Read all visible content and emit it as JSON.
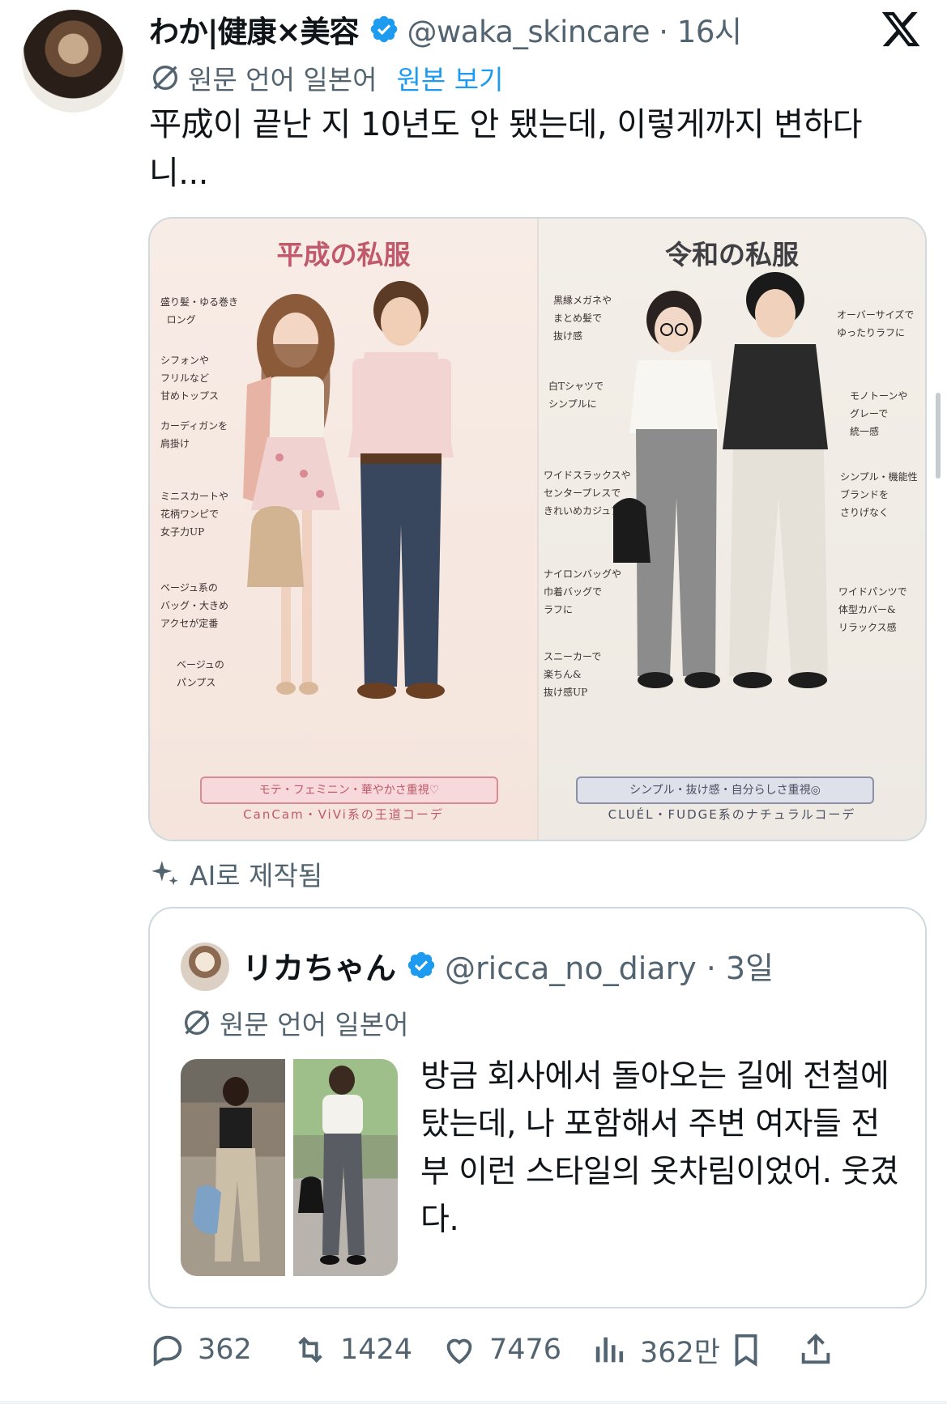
{
  "tweet": {
    "author_name": "わか|健康×美容",
    "handle_time": "@waka_skincare · 16시",
    "translation_note": "원문 언어 일본어",
    "show_original": "원본 보기",
    "text": "平成이 끝난 지 10년도 안 됐는데, 이렇게까지 변하다니...",
    "ai_label": "AI로 제작됨"
  },
  "image": {
    "left_panel": {
      "title": "平成の私服",
      "notes": [
        "盛り髪・ゆる巻き\n  ロング",
        "シフォンや\nフリルなど\n甘めトップス",
        "カーディガンを\n肩掛け",
        "ミニスカートや\n花柄ワンピで\n女子力UP",
        "ベージュ系の\nバッグ・大きめ\nアクセが定番",
        "ベージュの\nパンプス"
      ],
      "tagline": "モテ・フェミニン・華やかさ重視♡",
      "caption": "CanCam・ViVi系の王道コーデ"
    },
    "right_panel": {
      "title": "令和の私服",
      "notes_left": [
        "黒縁メガネや\nまとめ髪で\n抜け感",
        "白Tシャツで\nシンプルに",
        "ワイドスラックスや\nセンタープレスで\nきれいめカジュアル",
        "ナイロンバッグや\n巾着バッグで\nラフに",
        "スニーカーで\n楽ちん&\n抜け感UP"
      ],
      "notes_right": [
        "オーバーサイズで\nゆったりラフに",
        "モノトーンや\nグレーで\n統一感",
        "シンプル・機能性\nブランドを\nさりげなく",
        "ワイドパンツで\n体型カバー&\nリラックス感"
      ],
      "tagline": "シンプル・抜け感・自分らしさ重視◎",
      "caption": "CLUÉL・FUDGE系のナチュラルコーデ"
    }
  },
  "quote": {
    "author_name": "リカちゃん",
    "handle_time": "@ricca_no_diary · 3일",
    "translation_note": "원문 언어 일본어",
    "text": "방금 회사에서 돌아오는 길에 전철에 탔는데, 나 포함해서 주변 여자들 전부 이런 스타일의 옷차림이었어. 웃겼다."
  },
  "actions": {
    "replies": "362",
    "retweets": "1424",
    "likes": "7476",
    "views": "362만"
  },
  "colors": {
    "accent": "#1d9bf0",
    "secondary_text": "#536471",
    "border": "#cfd9de",
    "heisei_pink": "#c0596a",
    "reiwa_gray": "#4a4e63"
  }
}
